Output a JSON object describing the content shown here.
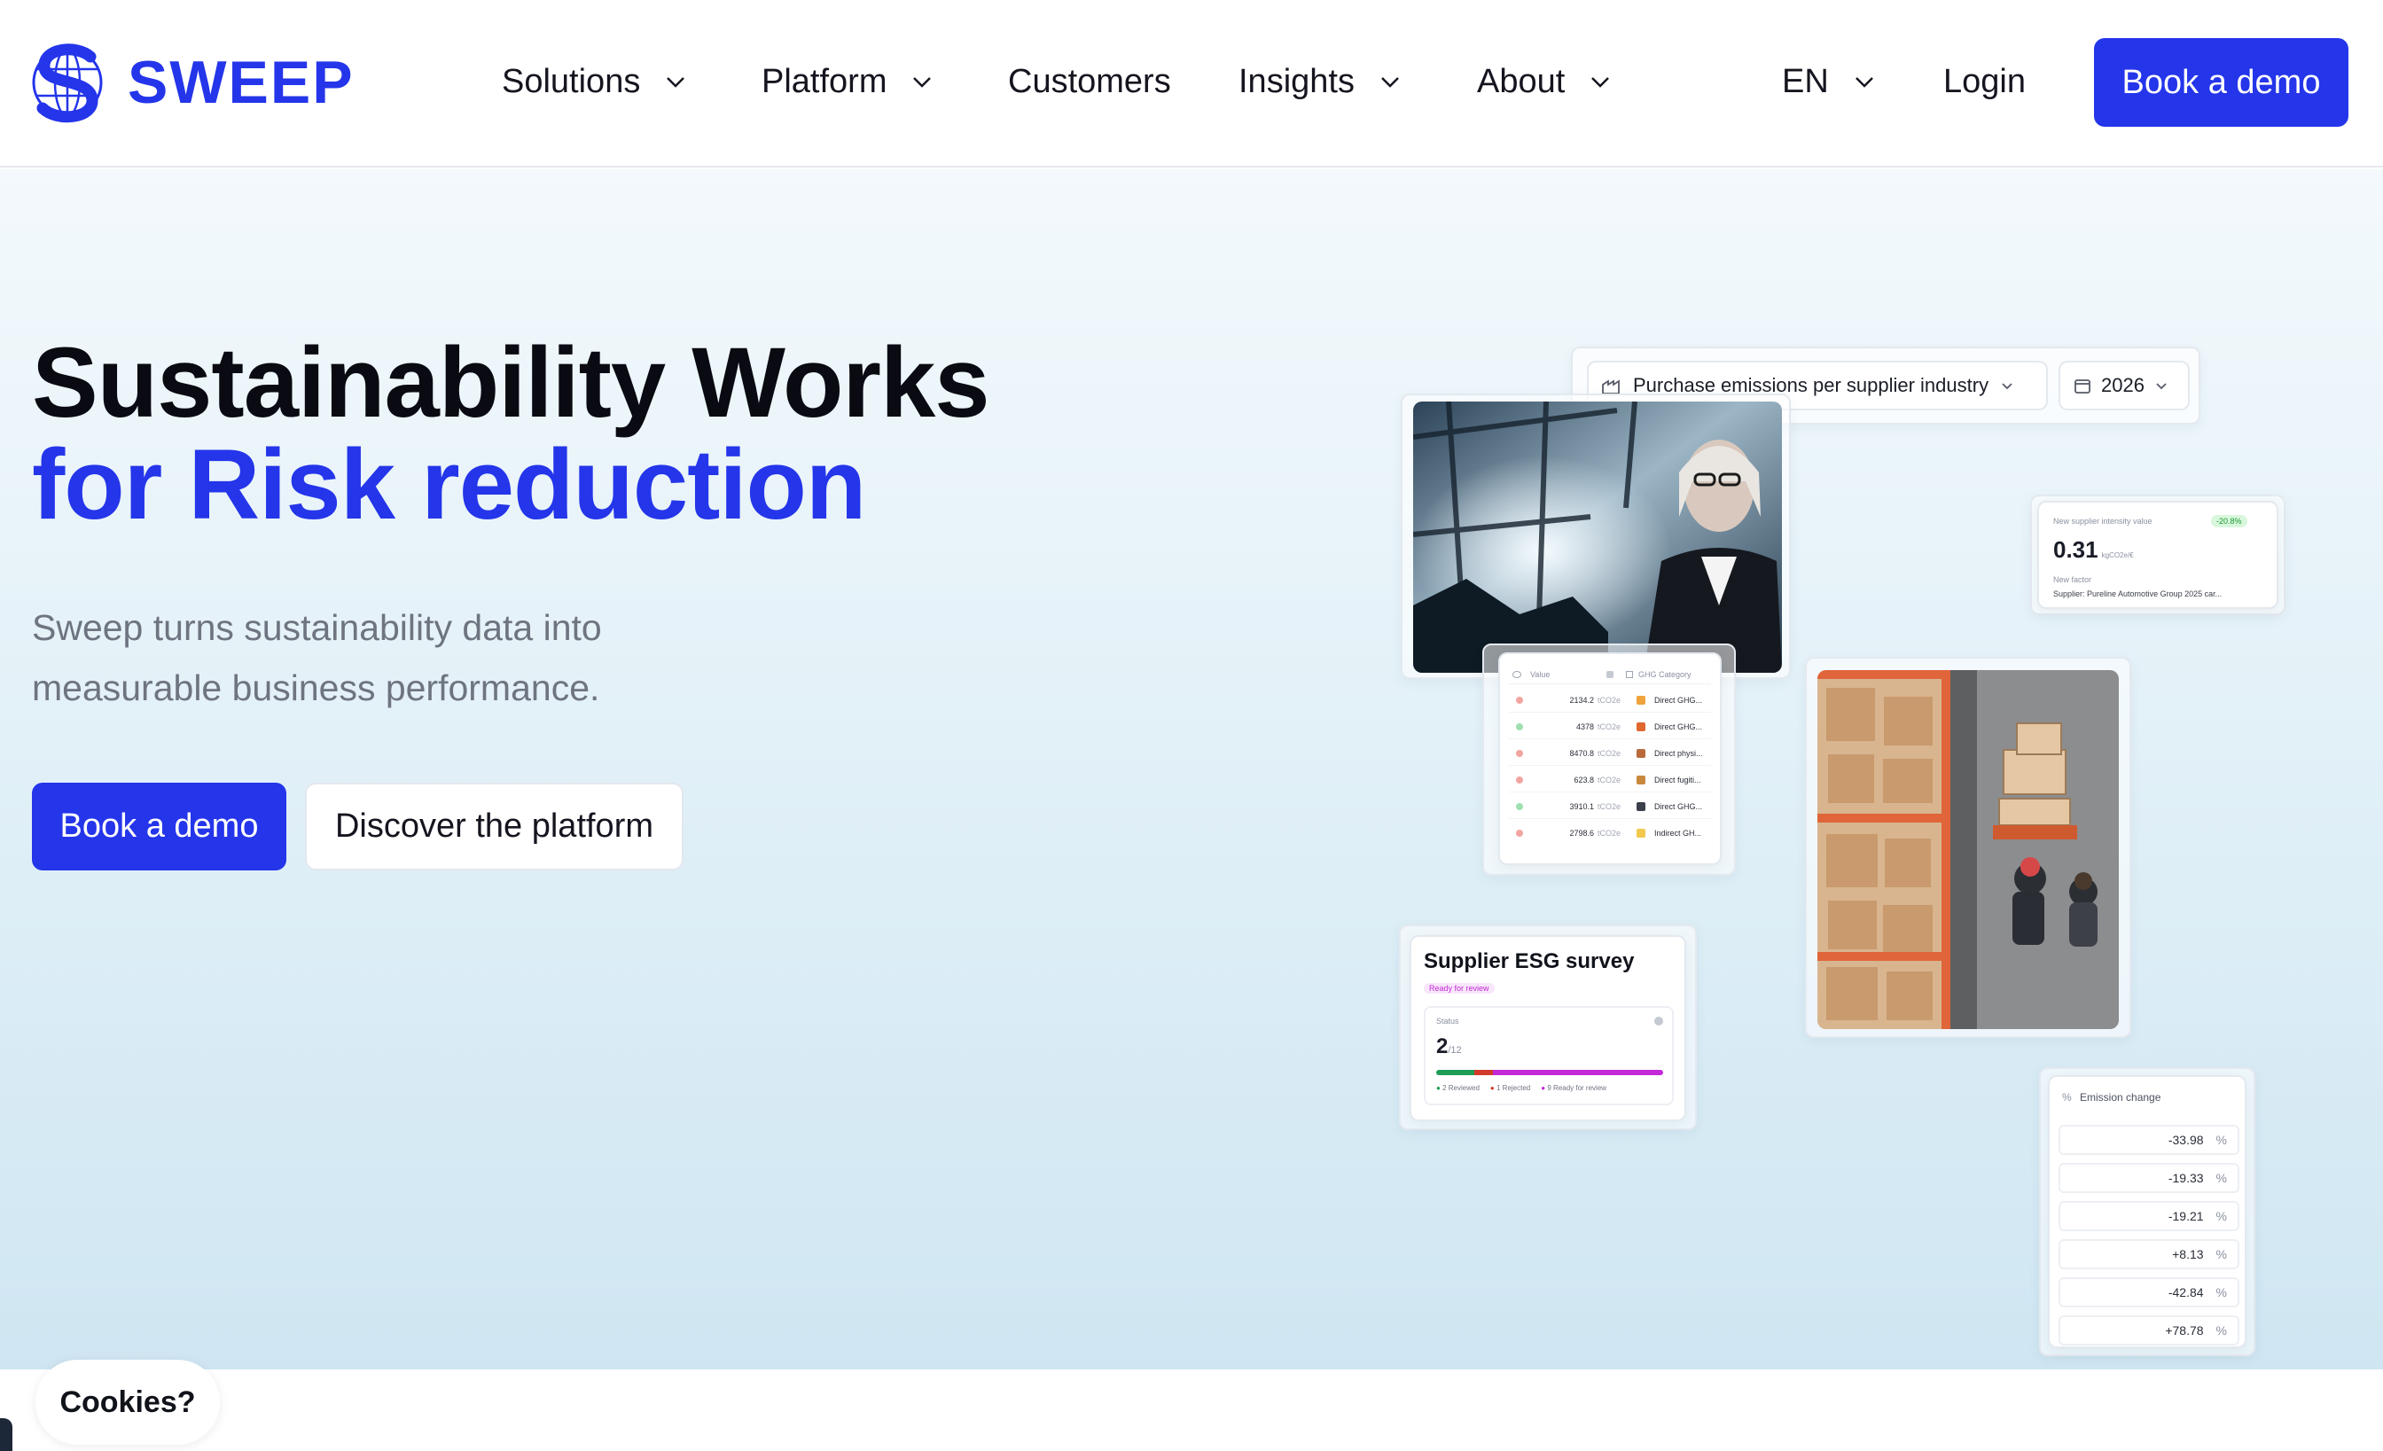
{
  "brand": {
    "name": "SWEEP",
    "accent": "#2435ea"
  },
  "nav": {
    "items": [
      {
        "label": "Solutions",
        "has_dropdown": true
      },
      {
        "label": "Platform",
        "has_dropdown": true
      },
      {
        "label": "Customers",
        "has_dropdown": false
      },
      {
        "label": "Insights",
        "has_dropdown": true
      },
      {
        "label": "About",
        "has_dropdown": true
      }
    ],
    "language": "EN",
    "login": "Login",
    "cta": "Book a demo"
  },
  "hero": {
    "title_line1": "Sustainability Works",
    "title_line2": "for Risk reduction",
    "subtitle": "Sweep turns sustainability data into measurable business performance.",
    "primary_cta": "Book a demo",
    "secondary_cta": "Discover the platform"
  },
  "dashboard": {
    "filter": "Purchase emissions per supplier industry",
    "year": "2026",
    "table": {
      "headers": [
        "Value",
        "GHG Category"
      ],
      "rows": [
        {
          "value": "2134.2",
          "unit": "tCO2e",
          "category": "Direct GHG...",
          "status": "red"
        },
        {
          "value": "4378",
          "unit": "tCO2e",
          "category": "Direct GHG...",
          "status": "green"
        },
        {
          "value": "8470.8",
          "unit": "tCO2e",
          "category": "Direct physi...",
          "status": "red"
        },
        {
          "value": "623.8",
          "unit": "tCO2e",
          "category": "Direct fugiti...",
          "status": "red"
        },
        {
          "value": "3910.1",
          "unit": "tCO2e",
          "category": "Direct GHG...",
          "status": "green"
        },
        {
          "value": "2798.6",
          "unit": "tCO2e",
          "category": "Indirect GH...",
          "status": "red"
        }
      ]
    },
    "intensity": {
      "label": "New supplier intensity value",
      "badge": "-20.8%",
      "value": "0.31",
      "unit": "kgCO2e/€",
      "factor_label": "New factor",
      "factor": "Supplier: Pureline Automotive Group 2025 car..."
    },
    "survey": {
      "title": "Supplier ESG survey",
      "badge": "Ready for review",
      "status_label": "Status",
      "count": "2",
      "total": "/12",
      "legend": [
        {
          "count": "2",
          "label": "Reviewed",
          "color": "#1f9d55"
        },
        {
          "count": "1",
          "label": "Rejected",
          "color": "#d23a2b"
        },
        {
          "count": "9",
          "label": "Ready for review",
          "color": "#c329d6"
        }
      ]
    },
    "emission_change": {
      "title": "Emission change",
      "values": [
        "-33.98",
        "-19.33",
        "-19.21",
        "+8.13",
        "-42.84",
        "+78.78"
      ],
      "unit": "%"
    }
  },
  "cookies": "Cookies?"
}
